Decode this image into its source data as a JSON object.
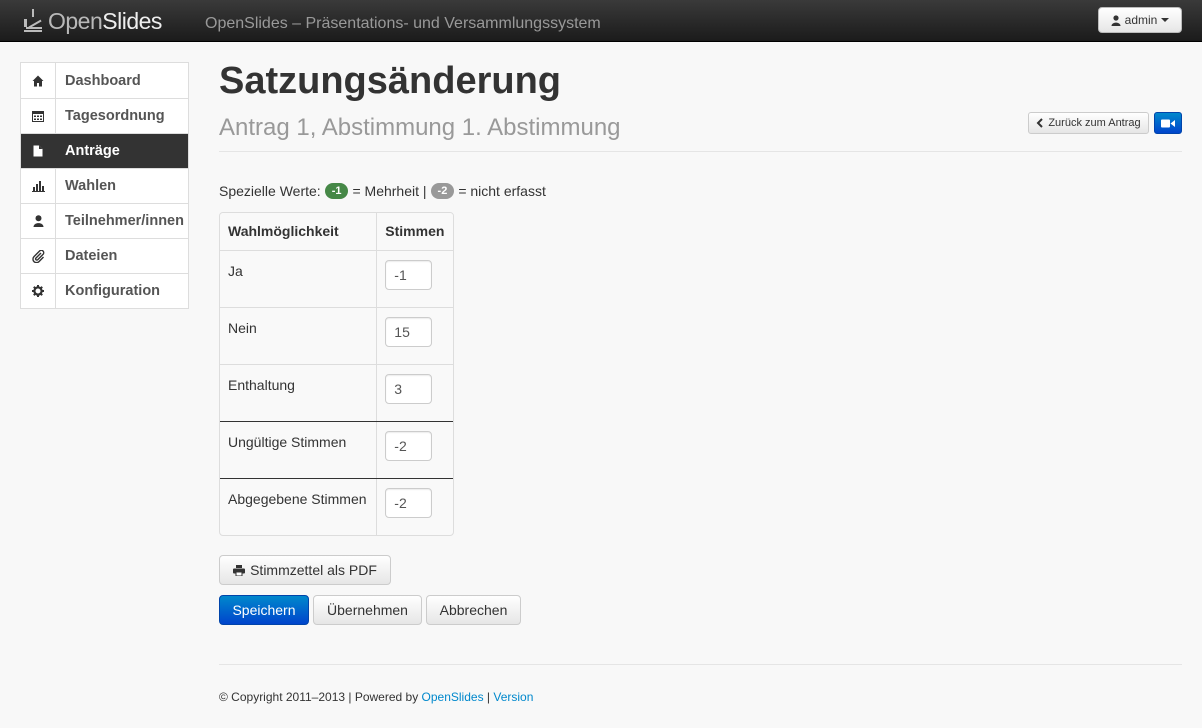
{
  "navbar": {
    "brand_open": "Open",
    "brand_slides": "Slides",
    "subtitle": "OpenSlides – Präsentations- und Versammlungssystem",
    "user_label": "admin"
  },
  "sidebar": {
    "items": [
      {
        "label": "Dashboard",
        "icon": "home-icon",
        "active": false
      },
      {
        "label": "Tagesordnung",
        "icon": "calendar-icon",
        "active": false
      },
      {
        "label": "Anträge",
        "icon": "file-icon",
        "active": true
      },
      {
        "label": "Wahlen",
        "icon": "bar-chart-icon",
        "active": false
      },
      {
        "label": "Teilnehmer/innen",
        "icon": "user-icon",
        "active": false
      },
      {
        "label": "Dateien",
        "icon": "paperclip-icon",
        "active": false
      },
      {
        "label": "Konfiguration",
        "icon": "gear-icon",
        "active": false
      }
    ]
  },
  "main": {
    "title": "Satzungsänderung",
    "subtitle": "Antrag 1, Abstimmung 1. Abstimmung",
    "back_button": "Zurück zum Antrag",
    "legend": {
      "prefix": "Spezielle Werte:",
      "badge1": "-1",
      "text1": "= Mehrheit |",
      "badge2": "-2",
      "text2": "= nicht erfasst"
    },
    "table": {
      "headers": [
        "Wahlmöglichkeit",
        "Stimmen"
      ],
      "rows": [
        {
          "label": "Ja",
          "value": "-1"
        },
        {
          "label": "Nein",
          "value": "15"
        },
        {
          "label": "Enthaltung",
          "value": "3"
        },
        {
          "label": "Ungültige Stimmen",
          "value": "-2"
        },
        {
          "label": "Abgegebene Stimmen",
          "value": "-2"
        }
      ]
    },
    "pdf_button": "Stimmzettel als PDF",
    "save_button": "Speichern",
    "apply_button": "Übernehmen",
    "cancel_button": "Abbrechen"
  },
  "footer": {
    "copyright": "© Copyright 2011–2013 | Powered by ",
    "link1": "OpenSlides",
    "sep": " | ",
    "link2": "Version"
  },
  "colors": {
    "primary": "#0044cc",
    "active_nav": "#333333",
    "badge_green": "#468847",
    "badge_gray": "#999999"
  }
}
